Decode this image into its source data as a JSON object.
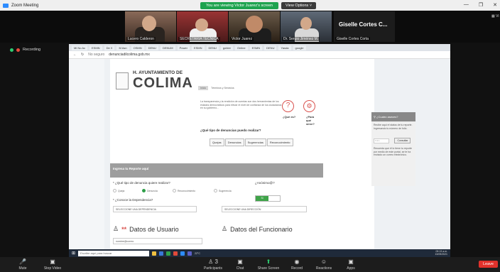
{
  "zoom": {
    "window_title": "Zoom Meeting",
    "banner_viewing": "You are viewing Victor Juarez's screen",
    "banner_options": "View Options ˅",
    "win_min": "—",
    "win_max": "❐",
    "win_close": "✕",
    "view_label": "▦ Vi",
    "recording_label": "Recording",
    "participants": [
      {
        "name": "Lucero Calderon"
      },
      {
        "name": "SECRETARÍA TÉCNICA"
      },
      {
        "name": "Victor Juarez"
      },
      {
        "name": "Dr. Sergio Jiménez M."
      },
      {
        "name": "Giselle Cortes Corta",
        "display_name": "Giselle Cortes C..."
      }
    ],
    "toolbar": [
      {
        "label": "Mute",
        "icon": "microphone-icon"
      },
      {
        "label": "Stop Video",
        "icon": "video-icon"
      },
      {
        "label": "Participants",
        "icon": "participants-icon",
        "count": "3"
      },
      {
        "label": "Chat",
        "icon": "chat-icon"
      },
      {
        "label": "Share Screen",
        "icon": "share-screen-icon"
      },
      {
        "label": "Record",
        "icon": "record-icon"
      },
      {
        "label": "Reactions",
        "icon": "reactions-icon"
      },
      {
        "label": "Apps",
        "icon": "apps-icon"
      }
    ],
    "leave_label": "Leave"
  },
  "browser": {
    "url": "denunciadilcolima.gob.mx",
    "security_text": "No seguro",
    "tabs": [
      "Mi No Ac",
      "ESMN",
      "De X",
      "M Asn",
      "OSMN",
      "DENU",
      "DENUM",
      "Power",
      "ESMN",
      "DENU",
      "gobier",
      "Online",
      "ESMN",
      "DENU",
      "Yasda",
      "google"
    ]
  },
  "site": {
    "org_small": "H. AYUNTAMIENTO DE",
    "org_big": "COLIMA",
    "nav": [
      "Inicio",
      "Términos y Servicios"
    ],
    "intro_text": "La transparencia y la rendición de cuentas son dos herramientas de los estados democráticos para elevar el nivel de confianza de los ciudadanos en su gobierno...",
    "que_es": "¿Qué es?",
    "para_que": "¿Para qué sirve?",
    "tipos_title": "¿Qué tipo de denuncias puedo realizar?",
    "tipos_buttons": [
      "Quejas",
      "Denuncias",
      "Sugerencias",
      "Reconocimiento"
    ],
    "side": {
      "header": "¿Cuatro aseces?",
      "text": "Recibe aquí el status de tu reporte. Ingresando tu número de folio.",
      "folio_placeholder": "Folio",
      "consult_button": "Consultar",
      "text2": "Recuerda que él lo tiene tu reporte por medio de este portal, se te ha enviado un correo electrónico."
    },
    "report_bar": "Ingresa tu Reporte aquí",
    "tipo_label": "* ¿Qué tipo de denuncia quiere realizar?",
    "tipo_options": [
      "Queja",
      "Denuncia",
      "Reconocimiento",
      "Sugerencia"
    ],
    "anonimo_label": "¿Anónimo@?",
    "toggle_value": "Si",
    "dependencia_label": "* ¿Conoce la Dependencia?",
    "dependencia_select": "SELECCIONE UNA DEPENDENCIA",
    "direccion_select": "SELECCIONE UNA DIRECCIÓN",
    "datos_usuario": "Datos de Usuario",
    "datos_funcionario": "Datos del Funcionario",
    "usuario_placeholder": "nombre@correo"
  },
  "taskbar": {
    "search_placeholder": "Escribe aquí para buscar",
    "weather": "22°C",
    "time": "09:13 a.m.",
    "date": "13/09/2021"
  }
}
